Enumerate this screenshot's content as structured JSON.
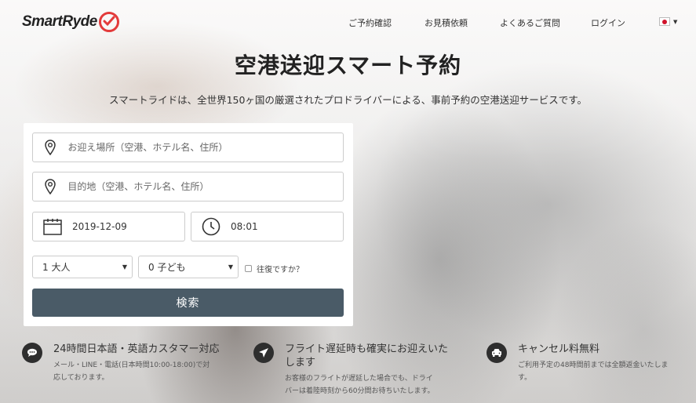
{
  "brand": {
    "name": "SmartRyde"
  },
  "nav": {
    "items": [
      {
        "label": "ご予約確認"
      },
      {
        "label": "お見積依頼"
      },
      {
        "label": "よくあるご質問"
      },
      {
        "label": "ログイン"
      }
    ],
    "language_icon": "japan-flag-icon"
  },
  "hero": {
    "title": "空港送迎スマート予約",
    "subtitle": "スマートライドは、全世界150ヶ国の厳選されたプロドライバーによる、事前予約の空港送迎サービスです。"
  },
  "form": {
    "pickup": {
      "placeholder": "お迎え場所（空港、ホテル名、住所）",
      "value": ""
    },
    "destination": {
      "placeholder": "目的地（空港、ホテル名、住所）",
      "value": ""
    },
    "date": {
      "value": "2019-12-09"
    },
    "time": {
      "value": "08:01"
    },
    "adults": {
      "selected": "1 大人"
    },
    "children": {
      "selected": "0 子ども"
    },
    "roundtrip_label": "往復ですか？",
    "submit_label": "検索"
  },
  "features": [
    {
      "icon": "chat-bubble-icon",
      "title": "24時間日本語・英語カスタマー対応",
      "desc_line1": "メール・LINE・電話(日本時間10:00-18:00)で対",
      "desc_line2": "応しております。"
    },
    {
      "icon": "airplane-icon",
      "title_line1": "フライト遅延時も確実にお迎えいた",
      "title_line2": "します",
      "desc_line1": "お客様のフライトが遅延した場合でも、ドライ",
      "desc_line2": "バーは着陸時刻から60分間お待ちいたします。"
    },
    {
      "icon": "car-icon",
      "title": "キャンセル料無料",
      "desc_line1": "ご利用予定の48時間前までは全額返金いたしま",
      "desc_line2": "す。"
    }
  ],
  "colors": {
    "accent": "#e33b3b",
    "button": "#4a5b67",
    "flag_red": "#d0122b"
  }
}
